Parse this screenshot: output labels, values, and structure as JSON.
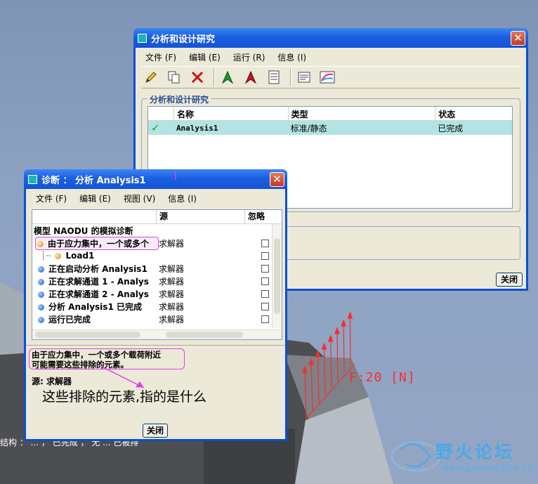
{
  "scene": {
    "status_text": "结构 ： ... ， 已完成 ， 无 ... 已被排",
    "force_label": "F:20 [N]",
    "watermark_title": "野火论坛",
    "watermark_url": "www.proewildfire.cn"
  },
  "main_window": {
    "title": "分析和设计研究",
    "menu": [
      "文件 (F)",
      "编辑 (E)",
      "运行 (R)",
      "信息 (I)"
    ],
    "toolbar_icons": [
      "edit-pencil-icon",
      "copy-icon",
      "delete-icon",
      "start-flag-icon",
      "stop-flag-icon",
      "list-icon",
      "report-icon",
      "results-icon"
    ],
    "group_title": "分析和设计研究",
    "columns": [
      "名称",
      "类型",
      "状态"
    ],
    "rows": [
      {
        "name": "Analysis1",
        "type": "标准/静态",
        "status": "已完成"
      }
    ],
    "close_label": "关闭"
  },
  "diag_window": {
    "title": "诊断 ： 分析 Analysis1",
    "menu": [
      "文件 (F)",
      "编辑 (E)",
      "视图 (V)",
      "信息 (I)"
    ],
    "columns": [
      "",
      "源",
      "忽略"
    ],
    "root_label": "模型 NAODU 的模拟诊断",
    "items": [
      {
        "label": "由于应力集中，一个或多个",
        "source": "求解器",
        "icon": "warning"
      },
      {
        "label": "Load1",
        "source": "",
        "icon": "warning"
      },
      {
        "label": "正在启动分析 Analysis1",
        "source": "求解器",
        "icon": "info"
      },
      {
        "label": "正在求解通道 1 - Analys",
        "source": "求解器",
        "icon": "info"
      },
      {
        "label": "正在求解通道 2 - Analys",
        "source": "求解器",
        "icon": "info"
      },
      {
        "label": "分析 Analysis1 已完成",
        "source": "求解器",
        "icon": "info"
      },
      {
        "label": "运行已完成",
        "source": "求解器",
        "icon": "info"
      }
    ],
    "message_line1": "由于应力集中，一个或多个载荷附近",
    "message_line2": "可能需要这些排除的元素。",
    "source_line": "源: 求解器",
    "close_label": "关闭"
  },
  "annotation": {
    "question": "这些排除的元素,指的是什么"
  }
}
